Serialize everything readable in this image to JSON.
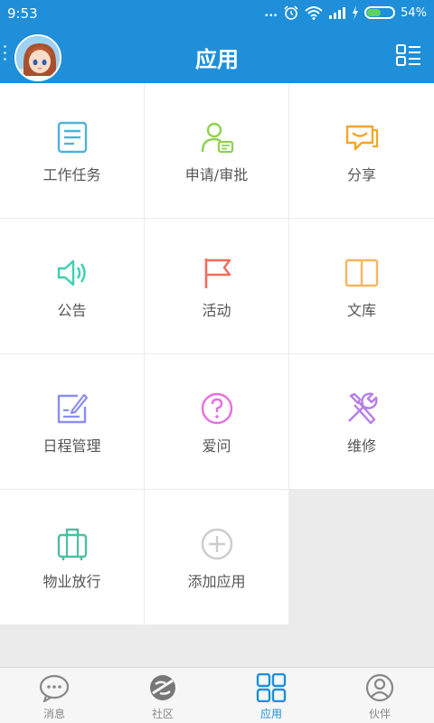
{
  "status_bar": {
    "time": "9:53",
    "signal_dots": "...",
    "battery_percent": "54%",
    "battery_level": 0.54
  },
  "header": {
    "title": "应用"
  },
  "apps": [
    {
      "label": "工作任务",
      "icon": "task-list-icon",
      "color": "#4fb3d9"
    },
    {
      "label": "申请/审批",
      "icon": "user-approval-icon",
      "color": "#8fd14f"
    },
    {
      "label": "分享",
      "icon": "chat-share-icon",
      "color": "#f5a623"
    },
    {
      "label": "公告",
      "icon": "speaker-icon",
      "color": "#3ccfb1"
    },
    {
      "label": "活动",
      "icon": "flag-icon",
      "color": "#f26d5b"
    },
    {
      "label": "文库",
      "icon": "book-icon",
      "color": "#f7b65d"
    },
    {
      "label": "日程管理",
      "icon": "schedule-edit-icon",
      "color": "#8b8ff0"
    },
    {
      "label": "爱问",
      "icon": "question-icon",
      "color": "#e56fe0"
    },
    {
      "label": "维修",
      "icon": "tools-icon",
      "color": "#b57ee8"
    },
    {
      "label": "物业放行",
      "icon": "luggage-icon",
      "color": "#4cbfa0"
    },
    {
      "label": "添加应用",
      "icon": "add-circle-icon",
      "color": "#cccccc"
    }
  ],
  "tabs": [
    {
      "label": "消息",
      "icon": "message-icon",
      "active": false
    },
    {
      "label": "社区",
      "icon": "community-icon",
      "active": false
    },
    {
      "label": "应用",
      "icon": "apps-grid-icon",
      "active": true
    },
    {
      "label": "伙伴",
      "icon": "partner-icon",
      "active": false
    }
  ],
  "colors": {
    "primary": "#1e8fd8",
    "background": "#ebebeb"
  }
}
